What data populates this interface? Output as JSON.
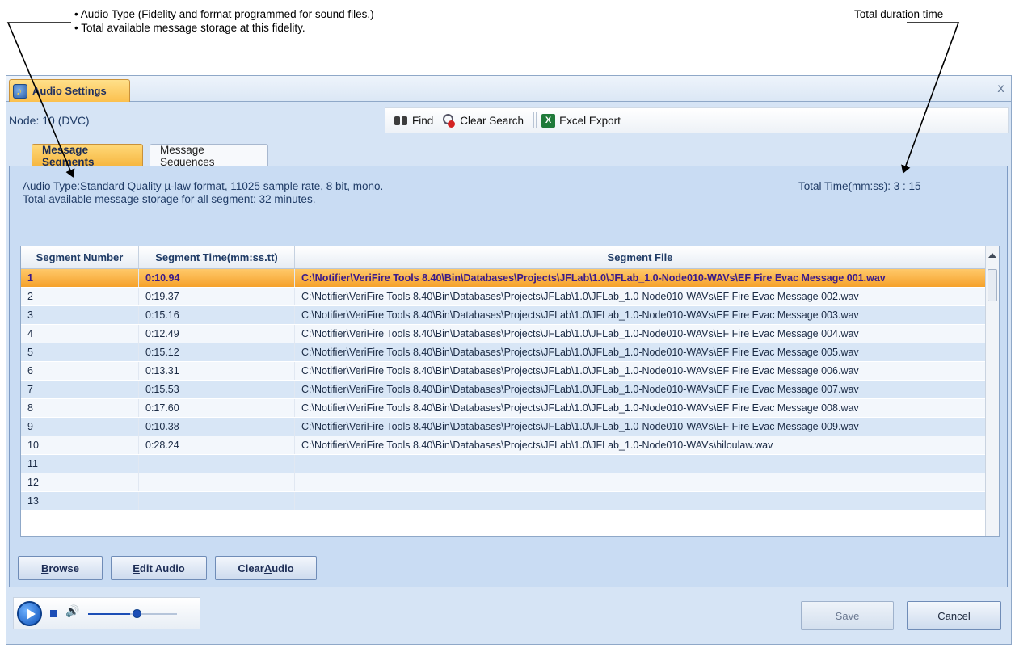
{
  "callouts": {
    "left_line1": "• Audio Type (Fidelity and format programmed for sound files.)",
    "left_line2": "• Total available message storage at this fidelity.",
    "right": "Total duration time"
  },
  "window": {
    "tab_title": "Audio Settings",
    "close_glyph": "x",
    "node": "Node: 10 (DVC)"
  },
  "toolbar": {
    "find": "Find",
    "clear_search": "Clear Search",
    "excel_export": "Excel Export",
    "excel_glyph": "X"
  },
  "tabs": [
    {
      "label": "Message Segments",
      "active": true
    },
    {
      "label": "Message Sequences",
      "active": false
    }
  ],
  "info": {
    "audio_type": "Audio Type:Standard Quality µ-law format, 11025 sample rate, 8 bit, mono.",
    "storage": "Total available message storage for all segment: 32 minutes.",
    "total_time": "Total Time(mm:ss): 3 : 15"
  },
  "grid": {
    "columns": [
      "Segment Number",
      "Segment Time(mm:ss.tt)",
      "Segment File"
    ],
    "rows": [
      {
        "num": "1",
        "time": "0:10.94",
        "file": "C:\\Notifier\\VeriFire Tools 8.40\\Bin\\Databases\\Projects\\JFLab\\1.0\\JFLab_1.0-Node010-WAVs\\EF Fire Evac Message 001.wav",
        "selected": true
      },
      {
        "num": "2",
        "time": "0:19.37",
        "file": "C:\\Notifier\\VeriFire Tools 8.40\\Bin\\Databases\\Projects\\JFLab\\1.0\\JFLab_1.0-Node010-WAVs\\EF Fire Evac Message 002.wav"
      },
      {
        "num": "3",
        "time": "0:15.16",
        "file": "C:\\Notifier\\VeriFire Tools 8.40\\Bin\\Databases\\Projects\\JFLab\\1.0\\JFLab_1.0-Node010-WAVs\\EF Fire Evac Message 003.wav"
      },
      {
        "num": "4",
        "time": "0:12.49",
        "file": "C:\\Notifier\\VeriFire Tools 8.40\\Bin\\Databases\\Projects\\JFLab\\1.0\\JFLab_1.0-Node010-WAVs\\EF Fire Evac Message 004.wav"
      },
      {
        "num": "5",
        "time": "0:15.12",
        "file": "C:\\Notifier\\VeriFire Tools 8.40\\Bin\\Databases\\Projects\\JFLab\\1.0\\JFLab_1.0-Node010-WAVs\\EF Fire Evac Message 005.wav"
      },
      {
        "num": "6",
        "time": "0:13.31",
        "file": "C:\\Notifier\\VeriFire Tools 8.40\\Bin\\Databases\\Projects\\JFLab\\1.0\\JFLab_1.0-Node010-WAVs\\EF Fire Evac Message 006.wav"
      },
      {
        "num": "7",
        "time": "0:15.53",
        "file": "C:\\Notifier\\VeriFire Tools 8.40\\Bin\\Databases\\Projects\\JFLab\\1.0\\JFLab_1.0-Node010-WAVs\\EF Fire Evac Message 007.wav"
      },
      {
        "num": "8",
        "time": "0:17.60",
        "file": "C:\\Notifier\\VeriFire Tools 8.40\\Bin\\Databases\\Projects\\JFLab\\1.0\\JFLab_1.0-Node010-WAVs\\EF Fire Evac Message 008.wav"
      },
      {
        "num": "9",
        "time": "0:10.38",
        "file": "C:\\Notifier\\VeriFire Tools 8.40\\Bin\\Databases\\Projects\\JFLab\\1.0\\JFLab_1.0-Node010-WAVs\\EF Fire Evac Message 009.wav"
      },
      {
        "num": "10",
        "time": "0:28.24",
        "file": "C:\\Notifier\\VeriFire Tools 8.40\\Bin\\Databases\\Projects\\JFLab\\1.0\\JFLab_1.0-Node010-WAVs\\hiloulaw.wav"
      },
      {
        "num": "11",
        "time": "",
        "file": ""
      },
      {
        "num": "12",
        "time": "",
        "file": ""
      },
      {
        "num": "13",
        "time": "",
        "file": ""
      }
    ]
  },
  "buttons": {
    "browse_pre": "",
    "browse_key": "B",
    "browse_post": "rowse",
    "edit_pre": "",
    "edit_key": "E",
    "edit_post": "dit Audio",
    "clear_pre": "Clear ",
    "clear_key": "A",
    "clear_post": "udio",
    "save_pre": "",
    "save_key": "S",
    "save_post": "ave",
    "cancel_pre": "",
    "cancel_key": "C",
    "cancel_post": "ancel"
  },
  "player": {
    "volume_level": 0.55,
    "volume_glyph": "🔊"
  },
  "colors": {
    "active_tab": "#f6b63f",
    "selected_row": "#f5a12b",
    "panel_bg": "#c9dcf3"
  }
}
